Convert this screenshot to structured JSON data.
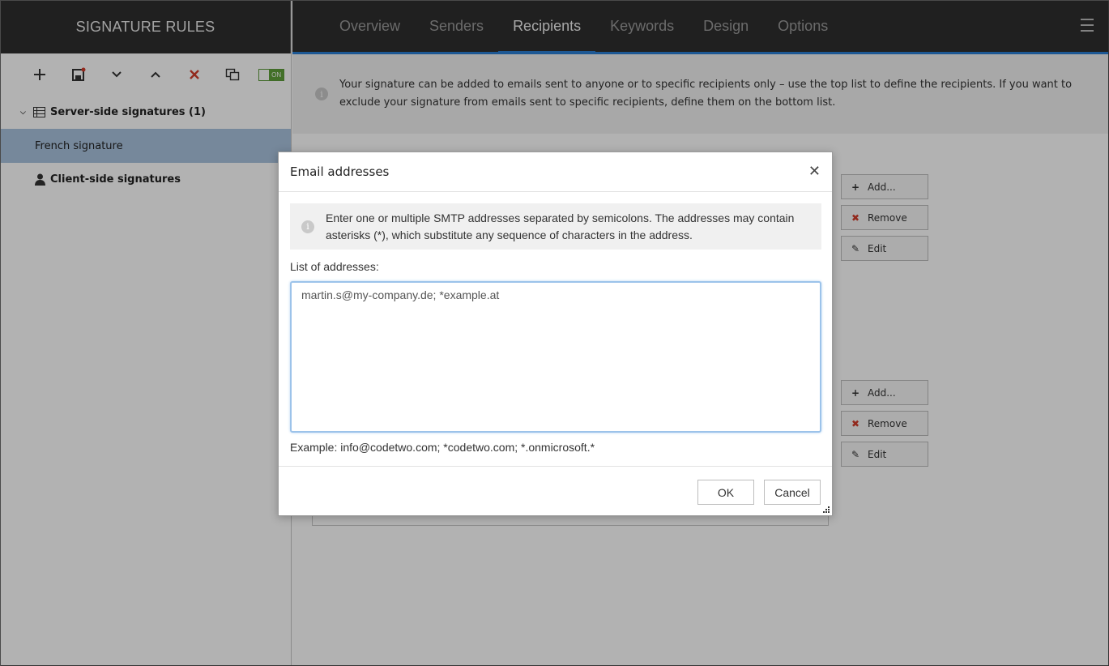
{
  "sidebar": {
    "title": "SIGNATURE RULES",
    "toggle_label": "ON",
    "groups": [
      {
        "label": "Server-side signatures (1)",
        "items": [
          {
            "label": "French signature"
          }
        ]
      },
      {
        "label": "Client-side signatures"
      }
    ]
  },
  "tabs": [
    {
      "label": "Overview"
    },
    {
      "label": "Senders"
    },
    {
      "label": "Recipients"
    },
    {
      "label": "Keywords"
    },
    {
      "label": "Design"
    },
    {
      "label": "Options"
    }
  ],
  "info_text": "Your signature can be added to emails sent to anyone or to specific recipients only – use the top list to define the recipients. If you want to exclude your signature from emails sent to specific recipients, define them on the bottom list.",
  "side_buttons": {
    "add": "Add...",
    "remove": "Remove",
    "edit": "Edit"
  },
  "dialog": {
    "title": "Email addresses",
    "info": "Enter one or multiple SMTP addresses separated by semicolons. The addresses may contain asterisks (*), which substitute any sequence of characters in the address.",
    "list_label": "List of addresses:",
    "addresses": "martin.s@my-company.de; *example.at",
    "example": "Example: info@codetwo.com; *codetwo.com; *.onmicrosoft.*",
    "ok": "OK",
    "cancel": "Cancel"
  },
  "colors": {
    "header_bg": "#2f2f2f",
    "accent": "#2a7fd4",
    "selected_item": "#a9c3df",
    "toggle_green": "#5fa13a",
    "remove_red": "#d23c2a"
  }
}
